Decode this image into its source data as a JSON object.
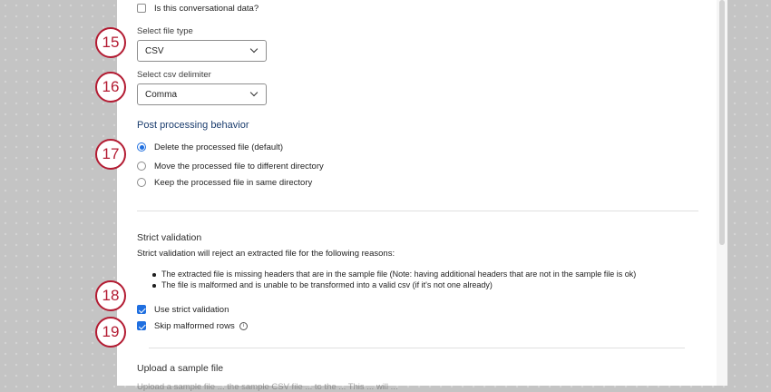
{
  "form": {
    "conversational_label": "Is this conversational data?",
    "file_type_label": "Select file type",
    "file_type_value": "CSV",
    "delimiter_label": "Select csv delimiter",
    "delimiter_value": "Comma",
    "post_processing_heading": "Post processing behavior",
    "post_processing_options": [
      {
        "label": "Delete the processed file (default)",
        "selected": true
      },
      {
        "label": "Move the processed file to different directory",
        "selected": false
      },
      {
        "label": "Keep the processed file in same directory",
        "selected": false
      }
    ],
    "strict_heading": "Strict validation",
    "strict_description": "Strict validation will reject an extracted file for the following reasons:",
    "strict_reasons": [
      "The extracted file is missing headers that are in the sample file (Note: having additional headers that are not in the sample file is ok)",
      "The file is malformed and is unable to be transformed into a valid csv (if it's not one already)"
    ],
    "use_strict_label": "Use strict validation",
    "use_strict_checked": true,
    "skip_malformed_label": "Skip malformed rows",
    "skip_malformed_checked": true,
    "upload_heading": "Upload a sample file",
    "upload_partial": "Upload a sample file ... the sample CSV file ... to the ... This ... will ..."
  },
  "callouts": [
    "15",
    "16",
    "17",
    "18",
    "19"
  ],
  "colors": {
    "accent": "#1f6fe0",
    "callout": "#b31b32",
    "heading_blue": "#1b3d6e"
  }
}
